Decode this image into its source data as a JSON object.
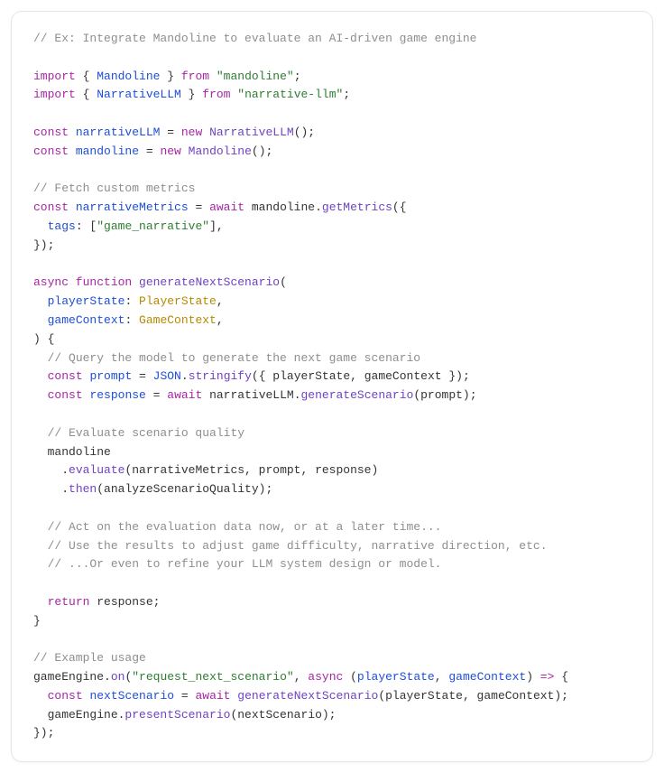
{
  "code": {
    "tokens": [
      {
        "c": "comment",
        "t": "// Ex: Integrate Mandoline to evaluate an AI-driven game engine"
      },
      {
        "c": "plain",
        "t": "\n\n"
      },
      {
        "c": "keyword",
        "t": "import"
      },
      {
        "c": "plain",
        "t": " { "
      },
      {
        "c": "ident",
        "t": "Mandoline"
      },
      {
        "c": "plain",
        "t": " } "
      },
      {
        "c": "keyword",
        "t": "from"
      },
      {
        "c": "plain",
        "t": " "
      },
      {
        "c": "string",
        "t": "\"mandoline\""
      },
      {
        "c": "plain",
        "t": ";\n"
      },
      {
        "c": "keyword",
        "t": "import"
      },
      {
        "c": "plain",
        "t": " { "
      },
      {
        "c": "ident",
        "t": "NarrativeLLM"
      },
      {
        "c": "plain",
        "t": " } "
      },
      {
        "c": "keyword",
        "t": "from"
      },
      {
        "c": "plain",
        "t": " "
      },
      {
        "c": "string",
        "t": "\"narrative-llm\""
      },
      {
        "c": "plain",
        "t": ";\n\n"
      },
      {
        "c": "keyword",
        "t": "const"
      },
      {
        "c": "plain",
        "t": " "
      },
      {
        "c": "ident",
        "t": "narrativeLLM"
      },
      {
        "c": "plain",
        "t": " = "
      },
      {
        "c": "keyword",
        "t": "new"
      },
      {
        "c": "plain",
        "t": " "
      },
      {
        "c": "func",
        "t": "NarrativeLLM"
      },
      {
        "c": "plain",
        "t": "();\n"
      },
      {
        "c": "keyword",
        "t": "const"
      },
      {
        "c": "plain",
        "t": " "
      },
      {
        "c": "ident",
        "t": "mandoline"
      },
      {
        "c": "plain",
        "t": " = "
      },
      {
        "c": "keyword",
        "t": "new"
      },
      {
        "c": "plain",
        "t": " "
      },
      {
        "c": "func",
        "t": "Mandoline"
      },
      {
        "c": "plain",
        "t": "();\n\n"
      },
      {
        "c": "comment",
        "t": "// Fetch custom metrics"
      },
      {
        "c": "plain",
        "t": "\n"
      },
      {
        "c": "keyword",
        "t": "const"
      },
      {
        "c": "plain",
        "t": " "
      },
      {
        "c": "ident",
        "t": "narrativeMetrics"
      },
      {
        "c": "plain",
        "t": " = "
      },
      {
        "c": "keyword",
        "t": "await"
      },
      {
        "c": "plain",
        "t": " mandoline."
      },
      {
        "c": "func",
        "t": "getMetrics"
      },
      {
        "c": "plain",
        "t": "({\n  "
      },
      {
        "c": "ident",
        "t": "tags"
      },
      {
        "c": "plain",
        "t": ": ["
      },
      {
        "c": "string",
        "t": "\"game_narrative\""
      },
      {
        "c": "plain",
        "t": "],\n});\n\n"
      },
      {
        "c": "keyword",
        "t": "async function"
      },
      {
        "c": "plain",
        "t": " "
      },
      {
        "c": "func",
        "t": "generateNextScenario"
      },
      {
        "c": "plain",
        "t": "(\n  "
      },
      {
        "c": "ident",
        "t": "playerState"
      },
      {
        "c": "plain",
        "t": ": "
      },
      {
        "c": "type",
        "t": "PlayerState"
      },
      {
        "c": "plain",
        "t": ",\n  "
      },
      {
        "c": "ident",
        "t": "gameContext"
      },
      {
        "c": "plain",
        "t": ": "
      },
      {
        "c": "type",
        "t": "GameContext"
      },
      {
        "c": "plain",
        "t": ",\n) {\n  "
      },
      {
        "c": "comment",
        "t": "// Query the model to generate the next game scenario"
      },
      {
        "c": "plain",
        "t": "\n  "
      },
      {
        "c": "keyword",
        "t": "const"
      },
      {
        "c": "plain",
        "t": " "
      },
      {
        "c": "ident",
        "t": "prompt"
      },
      {
        "c": "plain",
        "t": " = "
      },
      {
        "c": "ident",
        "t": "JSON"
      },
      {
        "c": "plain",
        "t": "."
      },
      {
        "c": "func",
        "t": "stringify"
      },
      {
        "c": "plain",
        "t": "({ playerState, gameContext });\n  "
      },
      {
        "c": "keyword",
        "t": "const"
      },
      {
        "c": "plain",
        "t": " "
      },
      {
        "c": "ident",
        "t": "response"
      },
      {
        "c": "plain",
        "t": " = "
      },
      {
        "c": "keyword",
        "t": "await"
      },
      {
        "c": "plain",
        "t": " narrativeLLM."
      },
      {
        "c": "func",
        "t": "generateScenario"
      },
      {
        "c": "plain",
        "t": "(prompt);\n\n  "
      },
      {
        "c": "comment",
        "t": "// Evaluate scenario quality"
      },
      {
        "c": "plain",
        "t": "\n  mandoline\n    ."
      },
      {
        "c": "func",
        "t": "evaluate"
      },
      {
        "c": "plain",
        "t": "(narrativeMetrics, prompt, response)\n    ."
      },
      {
        "c": "func",
        "t": "then"
      },
      {
        "c": "plain",
        "t": "(analyzeScenarioQuality);\n\n  "
      },
      {
        "c": "comment",
        "t": "// Act on the evaluation data now, or at a later time..."
      },
      {
        "c": "plain",
        "t": "\n  "
      },
      {
        "c": "comment",
        "t": "// Use the results to adjust game difficulty, narrative direction, etc."
      },
      {
        "c": "plain",
        "t": "\n  "
      },
      {
        "c": "comment",
        "t": "// ...Or even to refine your LLM system design or model."
      },
      {
        "c": "plain",
        "t": "\n\n  "
      },
      {
        "c": "keyword",
        "t": "return"
      },
      {
        "c": "plain",
        "t": " response;\n}\n\n"
      },
      {
        "c": "comment",
        "t": "// Example usage"
      },
      {
        "c": "plain",
        "t": "\ngameEngine."
      },
      {
        "c": "func",
        "t": "on"
      },
      {
        "c": "plain",
        "t": "("
      },
      {
        "c": "string",
        "t": "\"request_next_scenario\""
      },
      {
        "c": "plain",
        "t": ", "
      },
      {
        "c": "keyword",
        "t": "async"
      },
      {
        "c": "plain",
        "t": " ("
      },
      {
        "c": "ident",
        "t": "playerState"
      },
      {
        "c": "plain",
        "t": ", "
      },
      {
        "c": "ident",
        "t": "gameContext"
      },
      {
        "c": "plain",
        "t": ") "
      },
      {
        "c": "keyword",
        "t": "=>"
      },
      {
        "c": "plain",
        "t": " {\n  "
      },
      {
        "c": "keyword",
        "t": "const"
      },
      {
        "c": "plain",
        "t": " "
      },
      {
        "c": "ident",
        "t": "nextScenario"
      },
      {
        "c": "plain",
        "t": " = "
      },
      {
        "c": "keyword",
        "t": "await"
      },
      {
        "c": "plain",
        "t": " "
      },
      {
        "c": "func",
        "t": "generateNextScenario"
      },
      {
        "c": "plain",
        "t": "(playerState, gameContext);\n  gameEngine."
      },
      {
        "c": "func",
        "t": "presentScenario"
      },
      {
        "c": "plain",
        "t": "(nextScenario);\n});"
      }
    ]
  }
}
